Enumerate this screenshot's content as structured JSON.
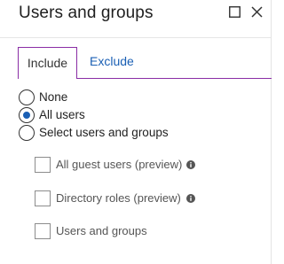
{
  "header": {
    "title": "Users and groups",
    "maximize_icon": "maximize-icon",
    "close_icon": "close-icon"
  },
  "tabs": [
    {
      "label": "Include",
      "selected": true
    },
    {
      "label": "Exclude",
      "selected": false
    }
  ],
  "radio_options": [
    {
      "label": "None",
      "checked": false
    },
    {
      "label": "All users",
      "checked": true
    },
    {
      "label": "Select users and groups",
      "checked": false
    }
  ],
  "checkbox_options": [
    {
      "label": "All guest users (preview)",
      "checked": false,
      "info_icon": "info-icon"
    },
    {
      "label": "Directory roles (preview)",
      "checked": false,
      "info_icon": "info-icon"
    },
    {
      "label": "Users and groups",
      "checked": false
    }
  ],
  "colors": {
    "accent": "#8a2da5",
    "link": "#1a5fb4",
    "radio_selected": "#1a5fb4"
  }
}
